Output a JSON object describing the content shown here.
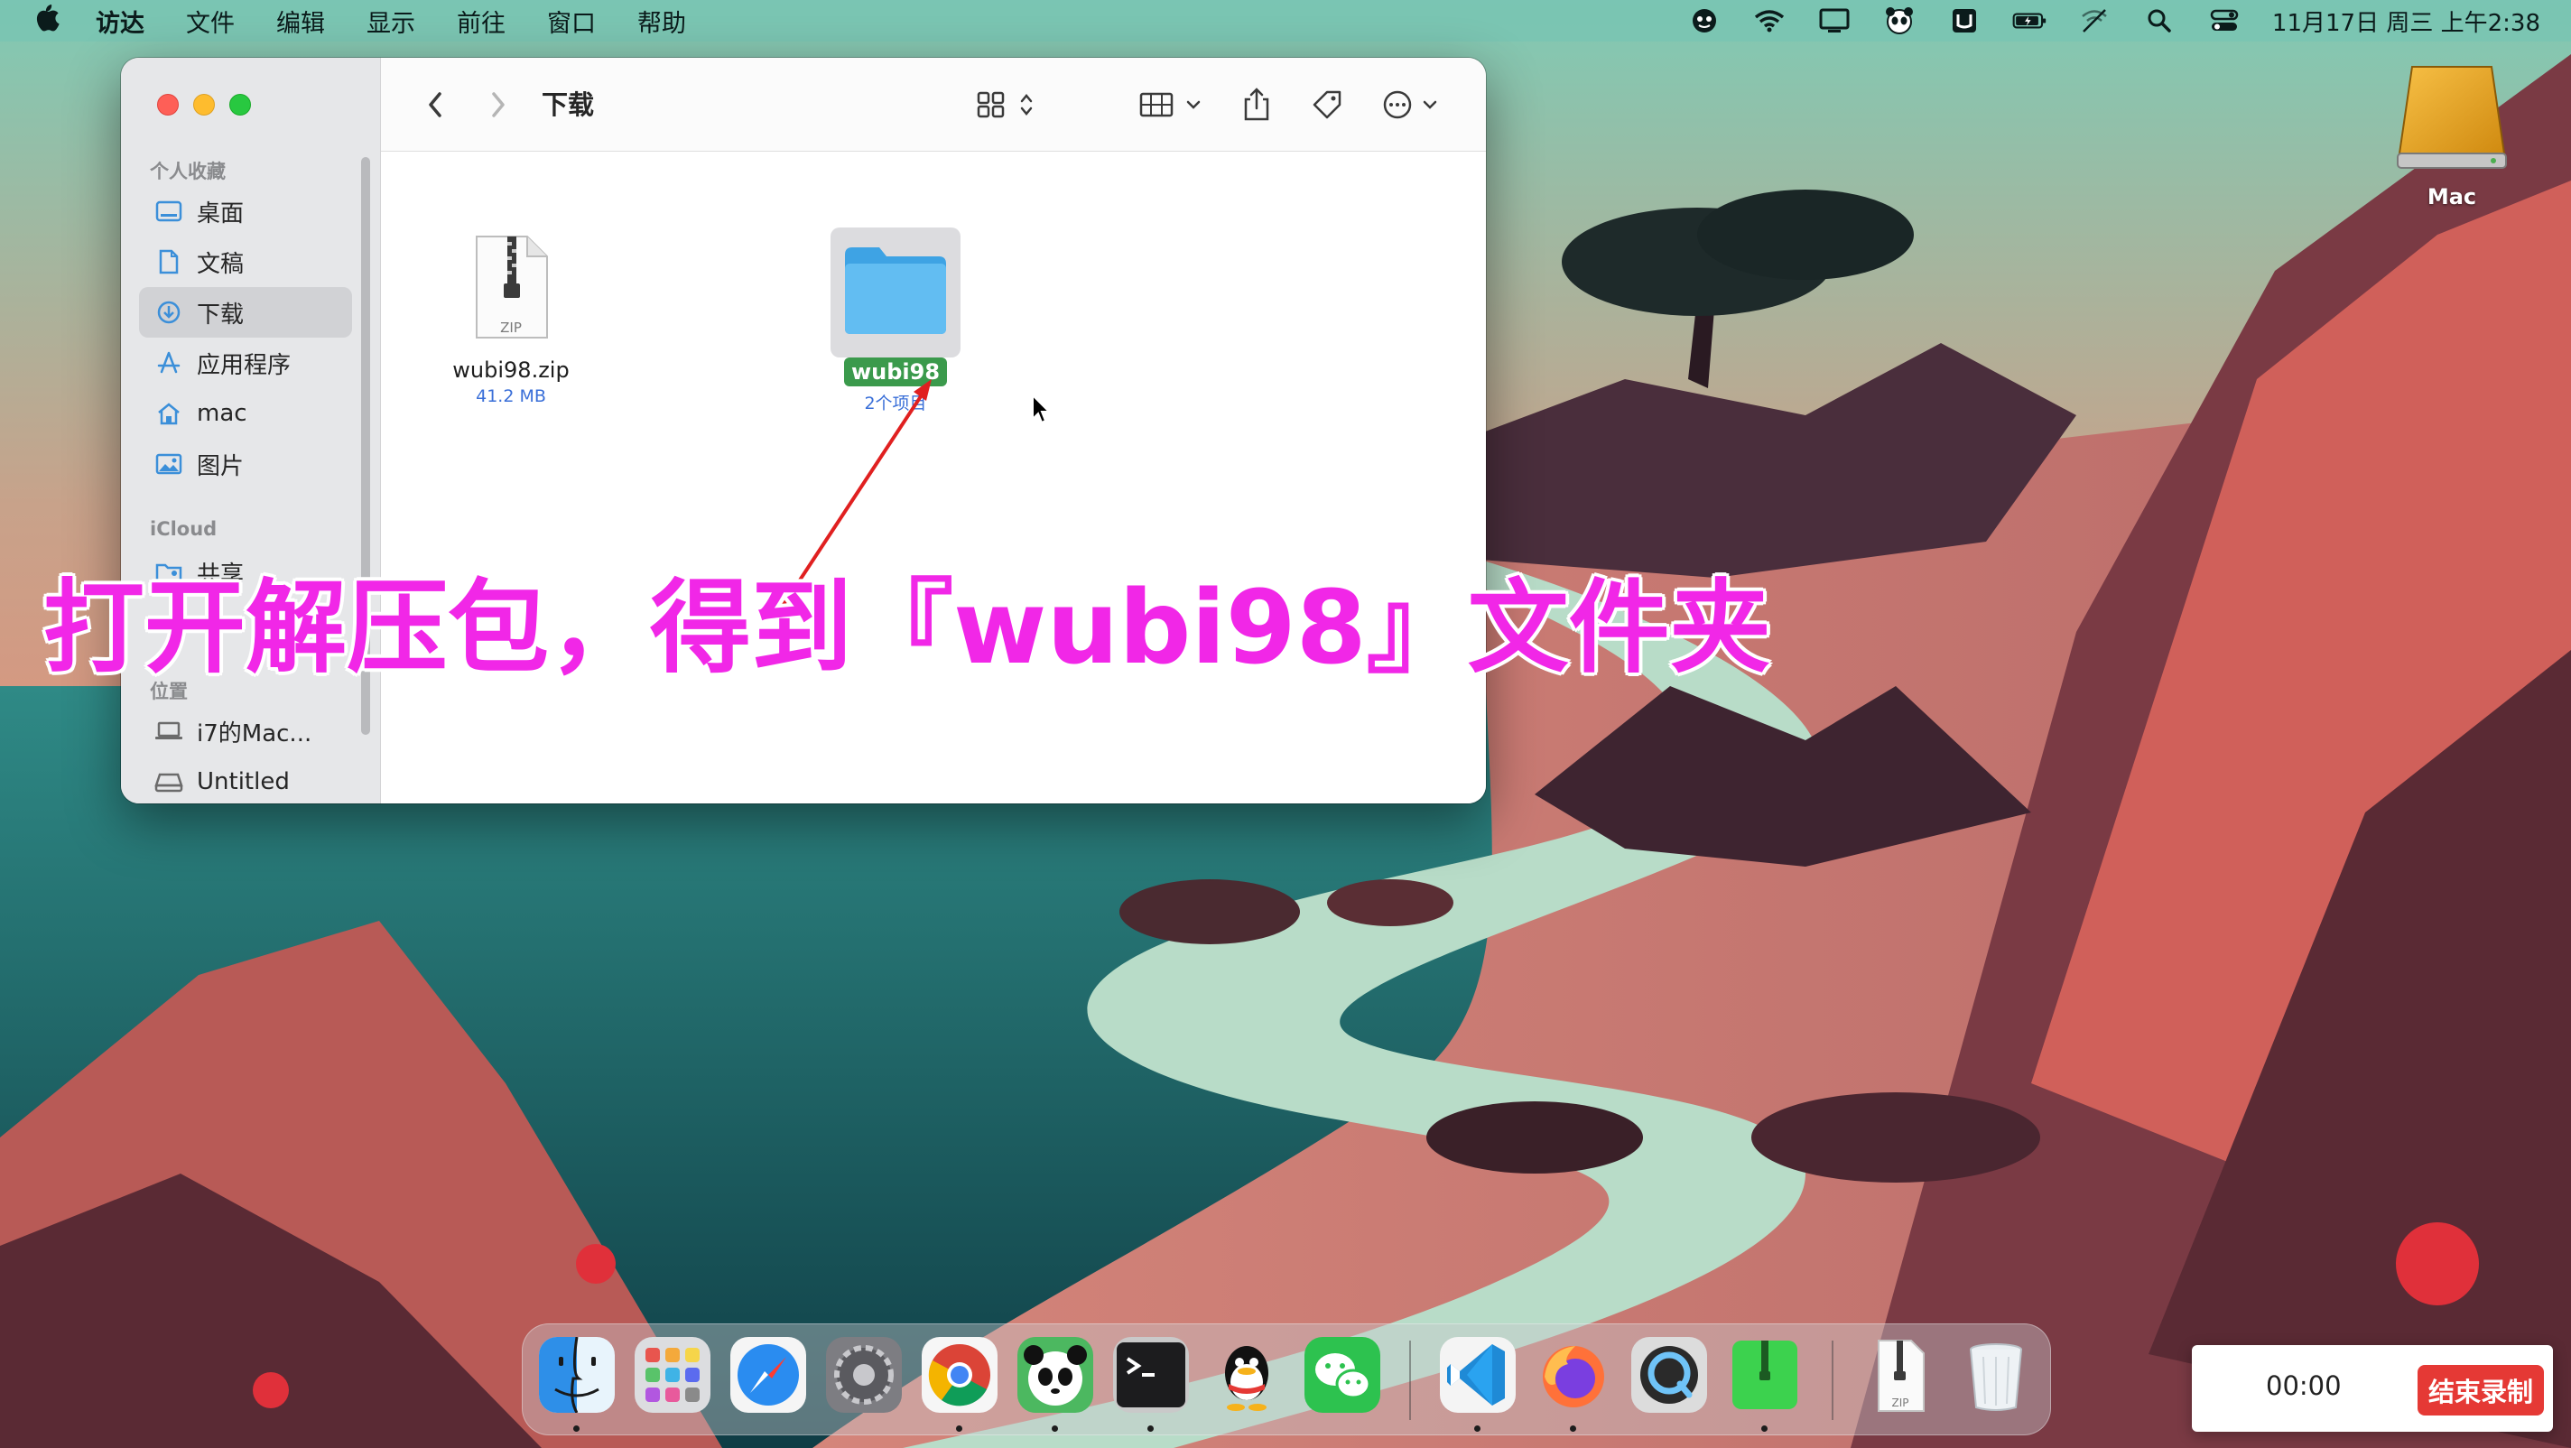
{
  "menubar": {
    "app_name": "访达",
    "menus": [
      "文件",
      "编辑",
      "显示",
      "前往",
      "窗口",
      "帮助"
    ],
    "clock": "11月17日 周三 上午2:38",
    "status_icons": [
      "face-icon",
      "wifi-icon",
      "display-icon",
      "panda-icon",
      "input-method-icon",
      "battery-icon",
      "airdrop-icon",
      "search-icon",
      "control-center-icon"
    ]
  },
  "finder": {
    "title": "下载",
    "sidebar": {
      "favorites_header": "个人收藏",
      "icloud_header": "iCloud",
      "locations_header": "位置",
      "favorites": [
        {
          "label": "桌面",
          "icon": "desktop-icon"
        },
        {
          "label": "文稿",
          "icon": "document-icon"
        },
        {
          "label": "下载",
          "icon": "download-icon",
          "selected": true
        },
        {
          "label": "应用程序",
          "icon": "applications-icon"
        },
        {
          "label": "mac",
          "icon": "home-icon"
        },
        {
          "label": "图片",
          "icon": "pictures-icon"
        }
      ],
      "icloud": [
        {
          "label": "共享",
          "icon": "shared-folder-icon"
        }
      ],
      "locations": [
        {
          "label": "i7的Mac...",
          "icon": "laptop-icon"
        },
        {
          "label": "Untitled",
          "icon": "disk-icon"
        }
      ]
    },
    "files": [
      {
        "name": "wubi98.zip",
        "sub": "41.2 MB",
        "badge": "ZIP",
        "icon": "zip-file-icon"
      },
      {
        "name": "wubi98",
        "sub": "2个项目",
        "icon": "folder-icon",
        "selected": true
      }
    ]
  },
  "desktop": {
    "drive_label": "Mac"
  },
  "caption": "打开解压包，得到『wubi98』文件夹",
  "dock": {
    "apps": [
      "finder-icon",
      "launchpad-icon",
      "safari-icon",
      "system-preferences-icon",
      "chrome-icon",
      "panda-vpn-icon",
      "terminal-icon",
      "qq-icon",
      "wechat-icon",
      "vscode-icon",
      "firefox-icon",
      "quicktime-icon",
      "archive-utility-icon",
      "zip-document-icon",
      "trash-icon"
    ],
    "zip_badge": "ZIP"
  },
  "recorder": {
    "time": "00:00",
    "stop_label": "结束录制",
    "stop_color": "#e53935"
  },
  "colors": {
    "caption": "#f127e7",
    "selection_green": "#3b9a4c",
    "folder_blue": "#5ab8ee"
  }
}
